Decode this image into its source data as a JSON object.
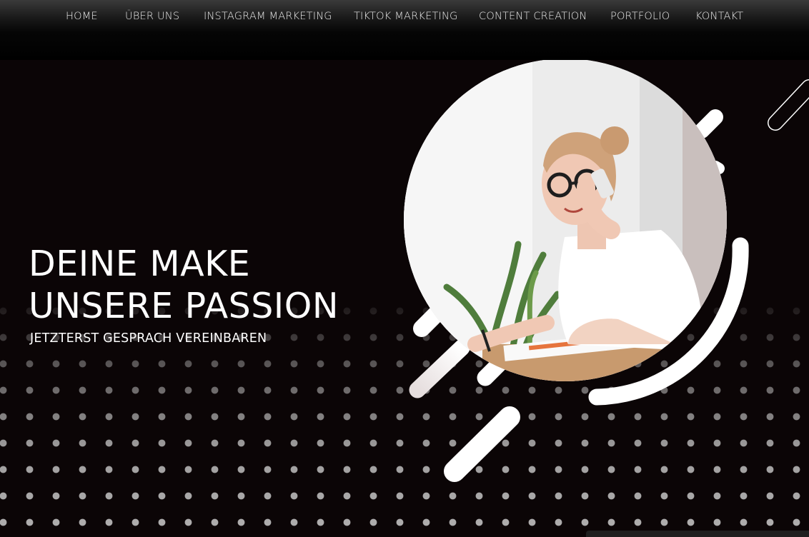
{
  "nav": {
    "items": [
      {
        "label": "HOME"
      },
      {
        "label": "ÜBER UNS"
      },
      {
        "label": "INSTAGRAM MARKETING"
      },
      {
        "label": "TIKTOK MARKETING"
      },
      {
        "label": "CONTENT CREATION"
      },
      {
        "label": "PORTFOLIO"
      },
      {
        "label": "KONTAKT"
      }
    ]
  },
  "hero": {
    "headline_line1": "DEINE MAKE",
    "headline_line2": "UNSERE PASSION",
    "cta_label": "JETZTERST GESPRACH VEREINBAREN",
    "image": "woman-on-phone-photo"
  },
  "colors": {
    "background": "#0b0506",
    "text": "#ffffff",
    "nav_text": "#e9e9e9",
    "accent_shapes": "#ffffff"
  }
}
